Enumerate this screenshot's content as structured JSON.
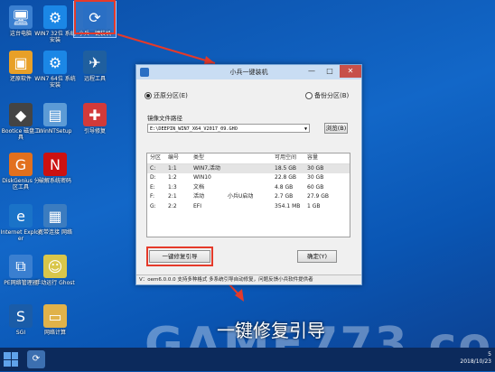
{
  "desktop": {
    "icons": [
      {
        "label": "这台电脑",
        "glyph": "🖥",
        "color": "#3a7fd0"
      },
      {
        "label": "WIN7 32位 系统安装",
        "glyph": "⚙",
        "color": "#1b87e6"
      },
      {
        "label": "小兵一键装机",
        "glyph": "⟳",
        "color": "#2a6fc4"
      },
      {
        "label": "还原软件",
        "glyph": "📦",
        "color": "#e8a028"
      },
      {
        "label": "WIN7 64位 系统安装",
        "glyph": "⚙",
        "color": "#1b87e6"
      },
      {
        "label": "远程工具",
        "glyph": "✈",
        "color": "#1f5f9f"
      },
      {
        "label": "Bootice 磁盘工具",
        "glyph": "◆",
        "color": "#444444"
      },
      {
        "label": "WinNTSetup",
        "glyph": "▤",
        "color": "#5c9bd6"
      },
      {
        "label": "引导修复",
        "glyph": "⛑",
        "color": "#d23a3a"
      },
      {
        "label": "DiskGenius 分区工具",
        "glyph": "G",
        "color": "#e2701e"
      },
      {
        "label": "破解系统密码",
        "glyph": "N",
        "color": "#cc1111"
      },
      {
        "label": "Internet Explorer",
        "glyph": "e",
        "color": "#1a73c8"
      },
      {
        "label": "宽带连接 网络",
        "glyph": "▦",
        "color": "#3b7cc0"
      },
      {
        "label": "PE网络管理器",
        "glyph": "⧉",
        "color": "#3a7fd0"
      },
      {
        "label": "手动运行 Ghost",
        "glyph": "👻",
        "color": "#d9c64a"
      },
      {
        "label": "SGI",
        "glyph": "S",
        "color": "#1a5ca8"
      },
      {
        "label": "网络计算",
        "glyph": "📁",
        "color": "#e0b24a"
      }
    ]
  },
  "window": {
    "title": "小兵一键装机",
    "min": "—",
    "max": "□",
    "close": "✕",
    "restore_label": "还原分区(E)",
    "backup_label": "备份分区(B)",
    "image_path_label": "镜像文件路径",
    "image_path": "E:\\DEEPIN_WIN7_X64_V2017_09.GHO",
    "browse_label": "浏览(B)",
    "table": {
      "headers": [
        "分区",
        "编号",
        "类型",
        "可用空间",
        "容量"
      ],
      "rows": [
        [
          "C:",
          "1:1",
          "WIN7,活动",
          "18.5 GB",
          "30 GB"
        ],
        [
          "D:",
          "1:2",
          "WIN10",
          "22.8 GB",
          "30 GB"
        ],
        [
          "E:",
          "1:3",
          "文档",
          "4.8 GB",
          "60 GB"
        ],
        [
          "F:",
          "2:1",
          "活动",
          "2.7 GB",
          "27.9 GB"
        ],
        [
          "G:",
          "2:2",
          "EFI",
          "354.1 MB",
          "1 GB"
        ]
      ],
      "sub_labels": [
        "",
        "",
        "",
        "小兵U启动",
        ""
      ]
    },
    "repair_button": "一键修复引导",
    "ok_button": "确定(Y)",
    "status": "V：oem6.0.0.0    支持多种格式 多系统引导自动修复，问题反馈小兵软件提供者"
  },
  "caption": "一键修复引导",
  "watermark": "GAME773.com",
  "taskbar": {
    "time": "5",
    "date": "2018/10/23"
  },
  "colors": {
    "accent_red": "#e53a2a",
    "selected_row": "#e4e4e4"
  }
}
